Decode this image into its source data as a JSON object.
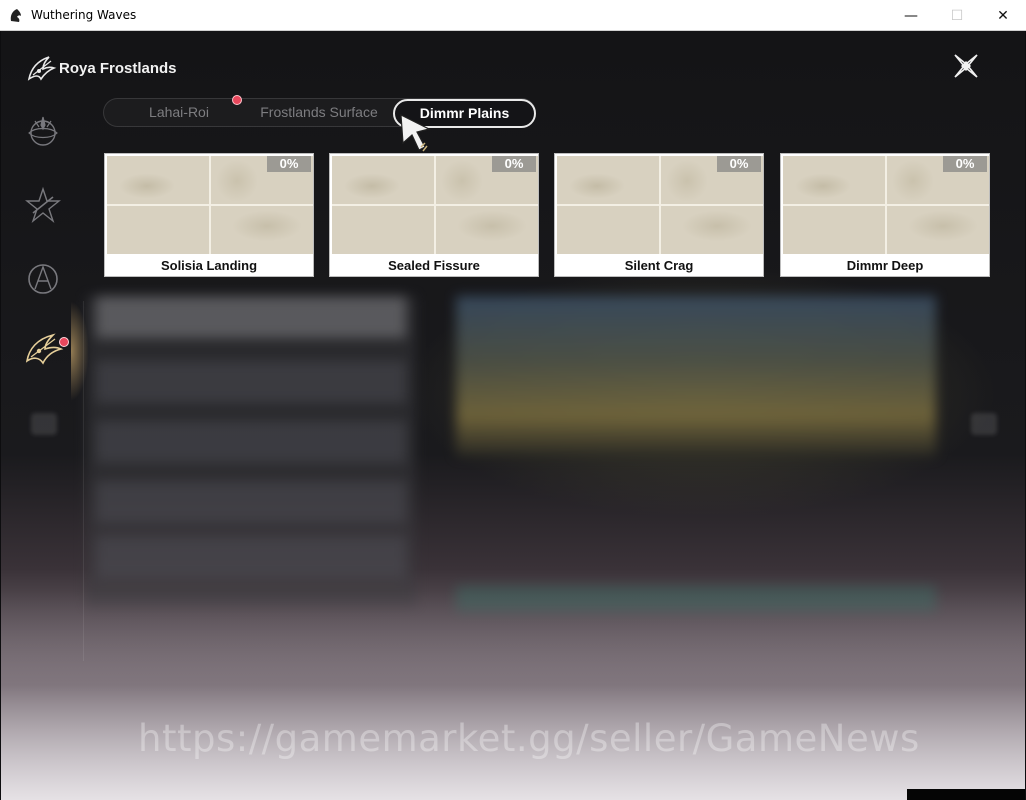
{
  "window": {
    "title": "Wuthering Waves",
    "controls": {
      "minimize": "—",
      "maximize": "☐",
      "close": "✕"
    }
  },
  "header": {
    "region_name": "Roya Frostlands",
    "icons": {
      "logo": "region-emblem-icon",
      "close": "close-x-icon"
    }
  },
  "sidebar": {
    "items": [
      {
        "name": "sidebar-item-1",
        "icon": "ornate-emblem-icon",
        "active": false
      },
      {
        "name": "sidebar-item-2",
        "icon": "star-emblem-icon",
        "active": false
      },
      {
        "name": "sidebar-item-3",
        "icon": "ring-emblem-icon",
        "active": false
      },
      {
        "name": "sidebar-item-4",
        "icon": "wing-emblem-icon",
        "active": true,
        "notification": true
      }
    ]
  },
  "tabs": [
    {
      "label": "Lahai-Roi",
      "active": false
    },
    {
      "label": "Frostlands Surface",
      "active": false,
      "notification": true
    },
    {
      "label": "Dimmr Plains",
      "active": true
    }
  ],
  "cards": [
    {
      "name": "Solisia Landing",
      "progress": "0%"
    },
    {
      "name": "Sealed Fissure",
      "progress": "0%"
    },
    {
      "name": "Silent Crag",
      "progress": "0%"
    },
    {
      "name": "Dimmr Deep",
      "progress": "0%"
    }
  ],
  "watermark": "https://gamemarket.gg/seller/GameNews",
  "colors": {
    "notification": "#e8475c",
    "active_tab_border": "#e9e9e9",
    "card_map": "#d8d1c0"
  }
}
